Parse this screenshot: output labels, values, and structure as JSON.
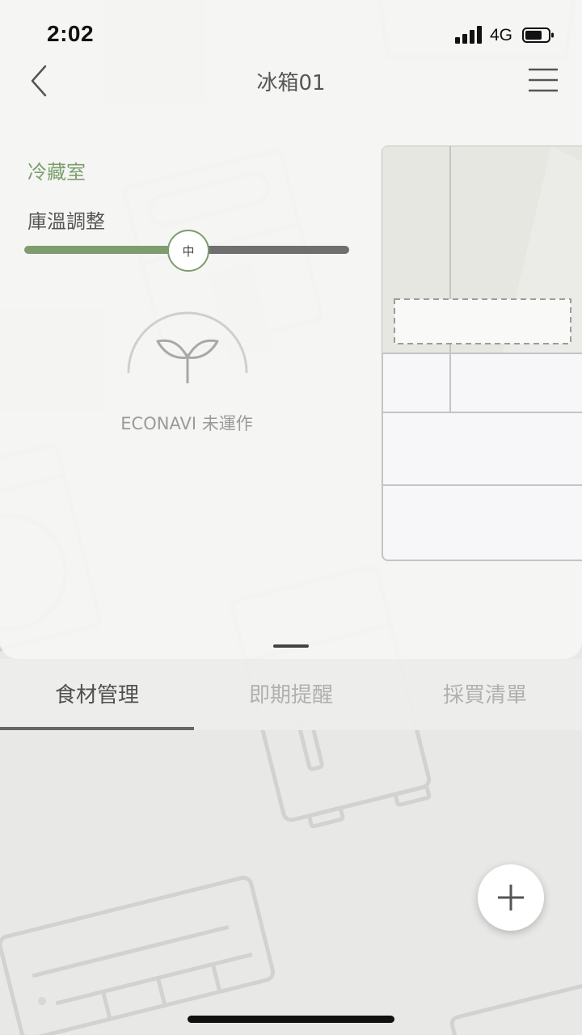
{
  "status_bar": {
    "time": "2:02",
    "network": "4G"
  },
  "nav": {
    "title": "冰箱01",
    "back_icon": "chevron-left-icon",
    "menu_icon": "hamburger-menu-icon"
  },
  "control": {
    "compartment": "冷藏室",
    "temp_label": "庫溫調整",
    "slider_value": "中",
    "slider_level": 0.5,
    "econavi_status": "ECONAVI 未運作",
    "econavi_icon": "sprout-icon"
  },
  "tabs": [
    {
      "label": "食材管理",
      "active": true
    },
    {
      "label": "即期提醒",
      "active": false
    },
    {
      "label": "採買清單",
      "active": false
    }
  ],
  "fab": {
    "icon": "plus-icon"
  },
  "colors": {
    "accent_green": "#7e9c6e",
    "slider_gray": "#6f6f6f",
    "text_dark": "#555555",
    "text_muted": "#b0b0b0"
  }
}
